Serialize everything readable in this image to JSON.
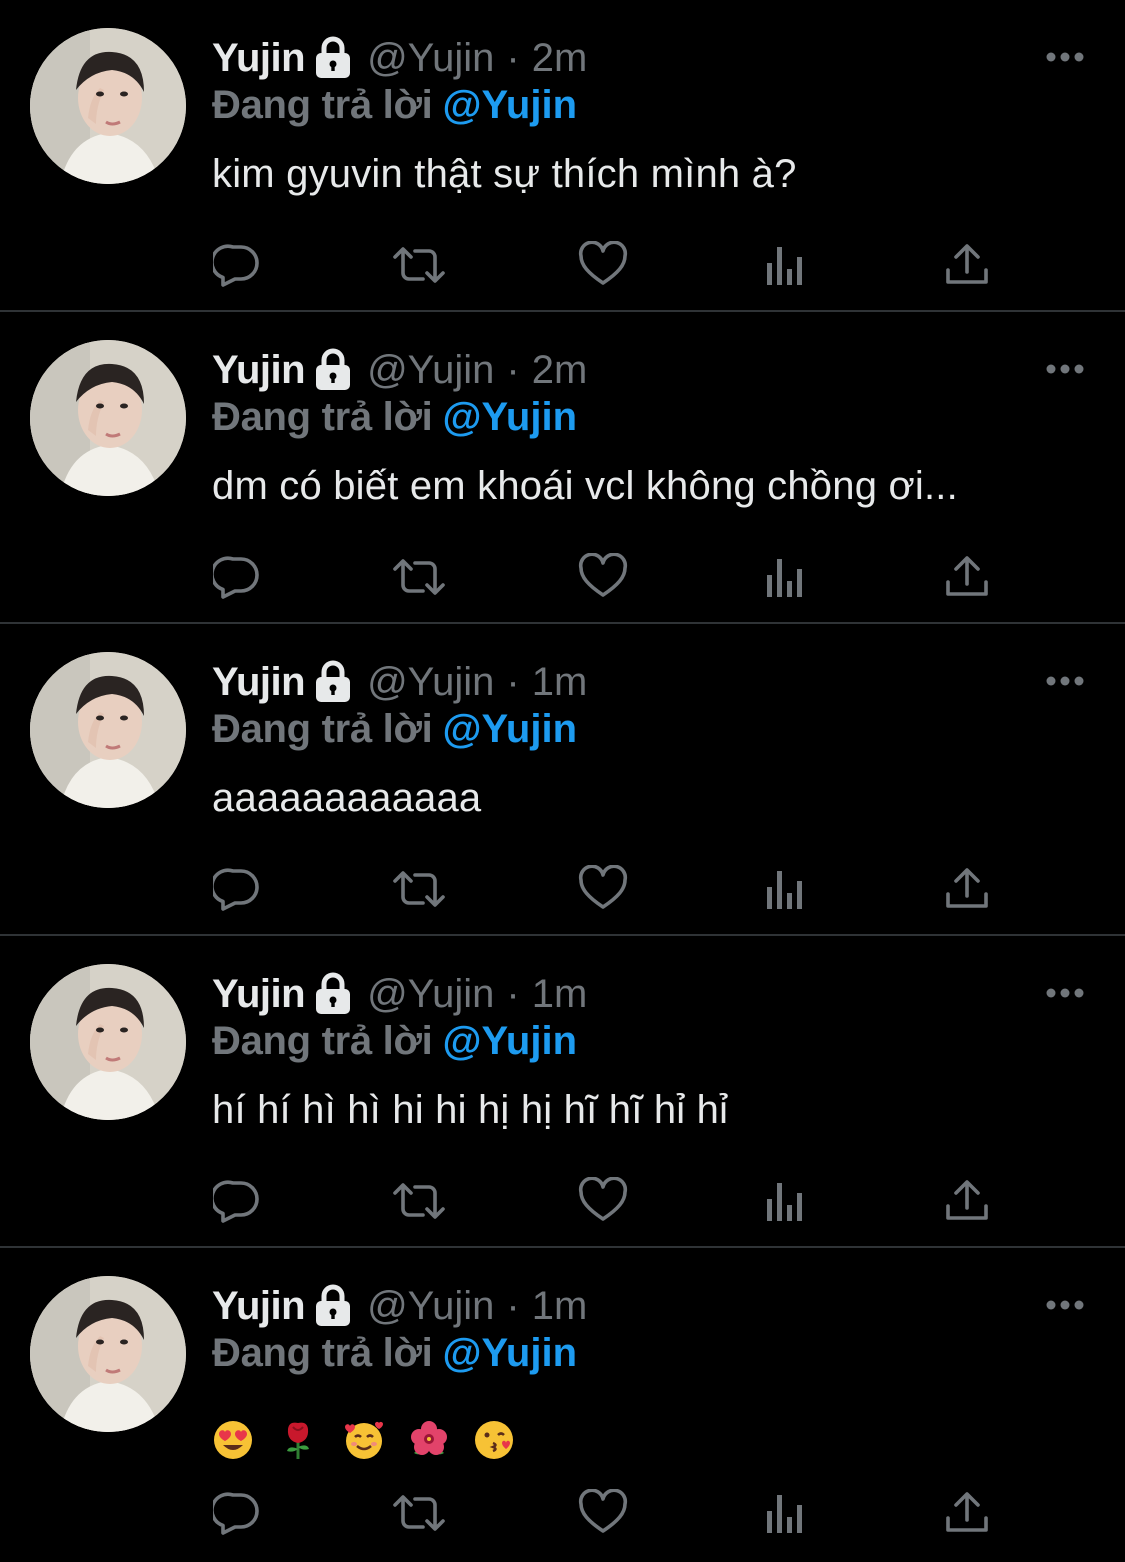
{
  "colors": {
    "background": "#000000",
    "primary_text": "#e7e9ea",
    "secondary_text": "#71767b",
    "accent": "#1d9bf0",
    "divider": "#2f3336"
  },
  "action_icons": [
    "reply-icon",
    "retweet-icon",
    "like-icon",
    "views-icon",
    "share-icon"
  ],
  "tweets": [
    {
      "display_name": "Yujin",
      "handle": "@Yujin",
      "separator": "·",
      "time": "2m",
      "reply_prefix": "Đang trả lời",
      "reply_target": "@Yujin",
      "text": "kim gyuvin thật sự thích mình à?"
    },
    {
      "display_name": "Yujin",
      "handle": "@Yujin",
      "separator": "·",
      "time": "2m",
      "reply_prefix": "Đang trả lời",
      "reply_target": "@Yujin",
      "text": "dm có biết em khoái vcl không chồng ơi..."
    },
    {
      "display_name": "Yujin",
      "handle": "@Yujin",
      "separator": "·",
      "time": "1m",
      "reply_prefix": "Đang trả lời",
      "reply_target": "@Yujin",
      "text": "aaaaaaaaaaaa"
    },
    {
      "display_name": "Yujin",
      "handle": "@Yujin",
      "separator": "·",
      "time": "1m",
      "reply_prefix": "Đang trả lời",
      "reply_target": "@Yujin",
      "text": "hí hí hì hì hi hi hị hị hĩ hĩ hỉ hỉ"
    },
    {
      "display_name": "Yujin",
      "handle": "@Yujin",
      "separator": "·",
      "time": "1m",
      "reply_prefix": "Đang trả lời",
      "reply_target": "@Yujin",
      "text": "",
      "emojis": [
        "heart-eyes-emoji",
        "rose-emoji",
        "smiling-face-with-hearts-emoji",
        "hibiscus-emoji",
        "kissing-face-emoji"
      ]
    }
  ]
}
